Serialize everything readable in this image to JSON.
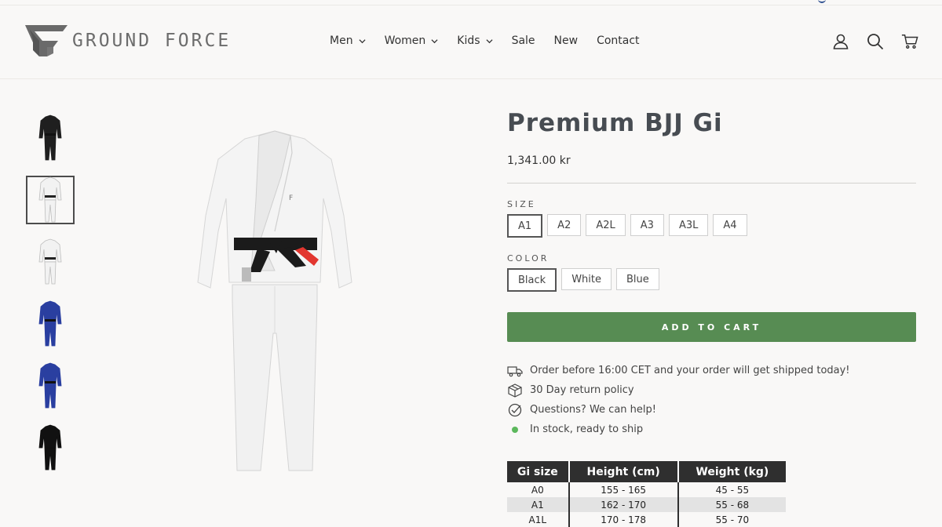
{
  "brand": {
    "name": "GROUND FORCE"
  },
  "nav": {
    "items": [
      {
        "label": "Men",
        "dropdown": true
      },
      {
        "label": "Women",
        "dropdown": true
      },
      {
        "label": "Kids",
        "dropdown": true
      },
      {
        "label": "Sale",
        "dropdown": false
      },
      {
        "label": "New",
        "dropdown": false
      },
      {
        "label": "Contact",
        "dropdown": false
      }
    ],
    "icons": [
      "account-icon",
      "search-icon",
      "cart-icon"
    ]
  },
  "gallery": {
    "thumbnails": [
      {
        "icon": "gi-black-thumb",
        "color": "#1f1f1f"
      },
      {
        "icon": "gi-white-thumb",
        "color": "#f2f2f2",
        "active": true
      },
      {
        "icon": "gi-white-thumb",
        "color": "#f2f2f2"
      },
      {
        "icon": "gi-blue-thumb",
        "color": "#2a3fa0"
      },
      {
        "icon": "gi-blue-thumb",
        "color": "#2a3fa0"
      },
      {
        "icon": "gi-black-thumb",
        "color": "#111111"
      }
    ]
  },
  "product": {
    "title": "Premium BJJ Gi",
    "price": "1,341.00 kr",
    "size": {
      "label": "SIZE",
      "options": [
        "A1",
        "A2",
        "A2L",
        "A3",
        "A3L",
        "A4"
      ],
      "selected": "A1"
    },
    "color": {
      "label": "COLOR",
      "options": [
        "Black",
        "White",
        "Blue"
      ],
      "selected": "Black"
    },
    "add_to_cart": "ADD TO CART",
    "info": [
      {
        "icon": "truck-icon",
        "text": "Order before 16:00 CET and your order will get shipped today!"
      },
      {
        "icon": "box-icon",
        "text": "30 Day return policy"
      },
      {
        "icon": "check-circle-icon",
        "text": "Questions? We can help!"
      },
      {
        "icon": "stock-dot-icon",
        "text": "In stock, ready to ship"
      }
    ]
  },
  "size_chart": {
    "headers": [
      "Gi size",
      "Height (cm)",
      "Weight (kg)"
    ],
    "rows": [
      [
        "A0",
        "155 - 165",
        "45 - 55"
      ],
      [
        "A1",
        "162 - 170",
        "55 - 68"
      ],
      [
        "A1L",
        "170 - 178",
        "55 - 70"
      ]
    ]
  },
  "colors": {
    "accent": "#578c53",
    "stock": "#5cb85c",
    "table_header": "#2f2f2f"
  }
}
